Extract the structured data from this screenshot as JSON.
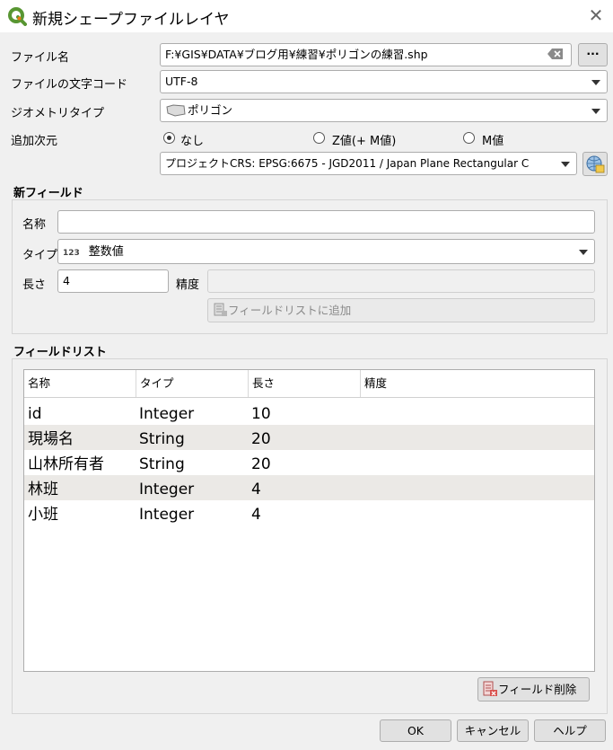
{
  "window": {
    "title": "新規シェープファイルレイヤ",
    "close_glyph": "✕"
  },
  "form": {
    "filename_label": "ファイル名",
    "filename_value": "F:¥GIS¥DATA¥ブログ用¥練習¥ポリゴンの練習.shp",
    "browse_label": "···",
    "encoding_label": "ファイルの文字コード",
    "encoding_value": "UTF-8",
    "geometry_label": "ジオメトリタイプ",
    "geometry_value": "ポリゴン",
    "dimensions_label": "追加次元",
    "dim_none": "なし",
    "dim_zm": "Z値(+ M値)",
    "dim_m": "M値",
    "dimensions_selected": "なし",
    "crs_value": "プロジェクトCRS: EPSG:6675 - JGD2011 / Japan Plane Rectangular C"
  },
  "new_field": {
    "group_title": "新フィールド",
    "name_label": "名称",
    "name_value": "",
    "type_label": "タイプ",
    "type_icon": "123",
    "type_value": "整数値",
    "length_label": "長さ",
    "length_value": "4",
    "precision_label": "精度",
    "precision_value": "",
    "add_button": "フィールドリストに追加"
  },
  "field_list": {
    "group_title": "フィールドリスト",
    "columns": [
      "名称",
      "タイプ",
      "長さ",
      "精度"
    ],
    "rows": [
      {
        "name": "id",
        "type": "Integer",
        "length": "10",
        "precision": ""
      },
      {
        "name": "現場名",
        "type": "String",
        "length": "20",
        "precision": ""
      },
      {
        "name": "山林所有者",
        "type": "String",
        "length": "20",
        "precision": ""
      },
      {
        "name": "林班",
        "type": "Integer",
        "length": "4",
        "precision": ""
      },
      {
        "name": "小班",
        "type": "Integer",
        "length": "4",
        "precision": ""
      }
    ],
    "delete_button": "フィールド削除"
  },
  "footer": {
    "ok": "OK",
    "cancel": "キャンセル",
    "help": "ヘルプ"
  },
  "colors": {
    "qgis_green": "#589632",
    "qgis_yellow": "#ee7913",
    "alt_row": "#ebe9e6"
  }
}
